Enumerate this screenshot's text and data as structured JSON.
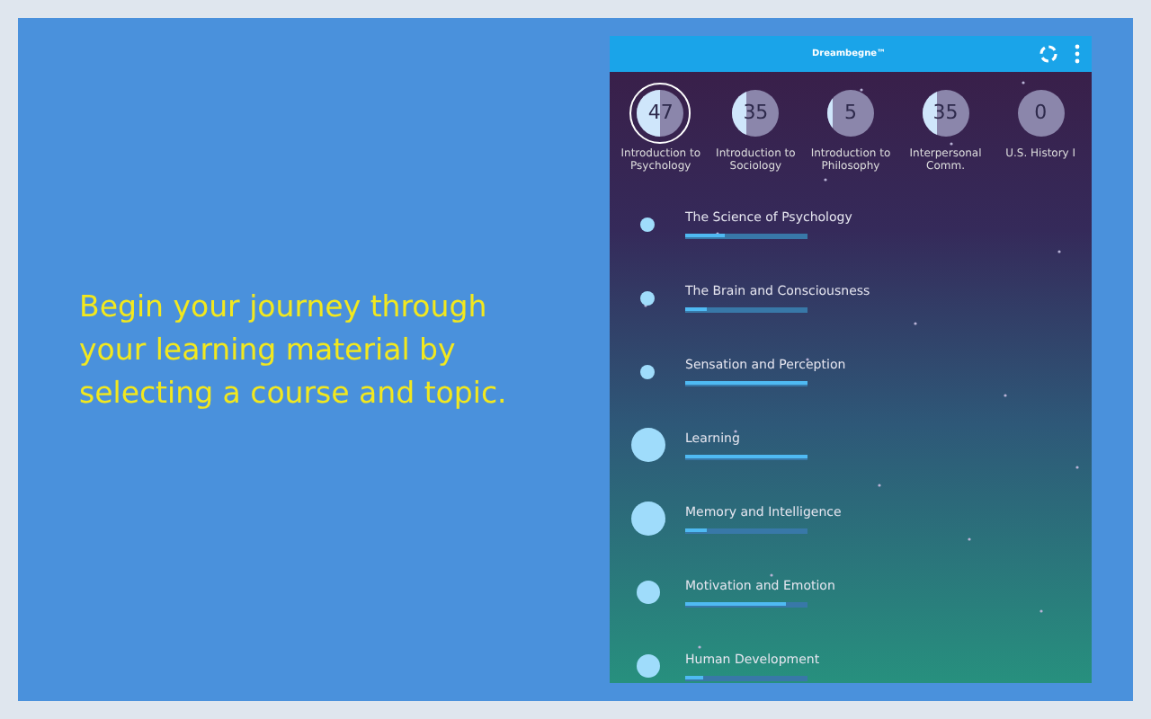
{
  "promo_text": "Begin your journey through your learning material by selecting a course and topic.",
  "app": {
    "title": "Dreambegne™",
    "courses": [
      {
        "name": "Introduction to Psychology",
        "count": "47",
        "level": 0.5,
        "selected": true
      },
      {
        "name": "Introduction to Sociology",
        "count": "35",
        "level": 0.3,
        "selected": false
      },
      {
        "name": "Introduction to Philosophy",
        "count": "5",
        "level": 0.1,
        "selected": false
      },
      {
        "name": "Interpersonal Comm.",
        "count": "35",
        "level": 0.3,
        "selected": false
      },
      {
        "name": "U.S. History I",
        "count": "0",
        "level": 0,
        "selected": false
      }
    ],
    "topics": [
      {
        "title": "The Science of Psychology",
        "kind": "small",
        "level": 0.32
      },
      {
        "title": "The Brain and Consciousness",
        "kind": "small",
        "level": 0.17
      },
      {
        "title": "Sensation and Perception",
        "kind": "small",
        "level": 1
      },
      {
        "title": "Learning",
        "kind": "large",
        "level": 1
      },
      {
        "title": "Memory and Intelligence",
        "kind": "large",
        "level": 0.17
      },
      {
        "title": "Motivation and Emotion",
        "kind": "medium",
        "level": 0.82
      },
      {
        "title": "Human Development",
        "kind": "medium",
        "level": 0.15
      }
    ]
  }
}
